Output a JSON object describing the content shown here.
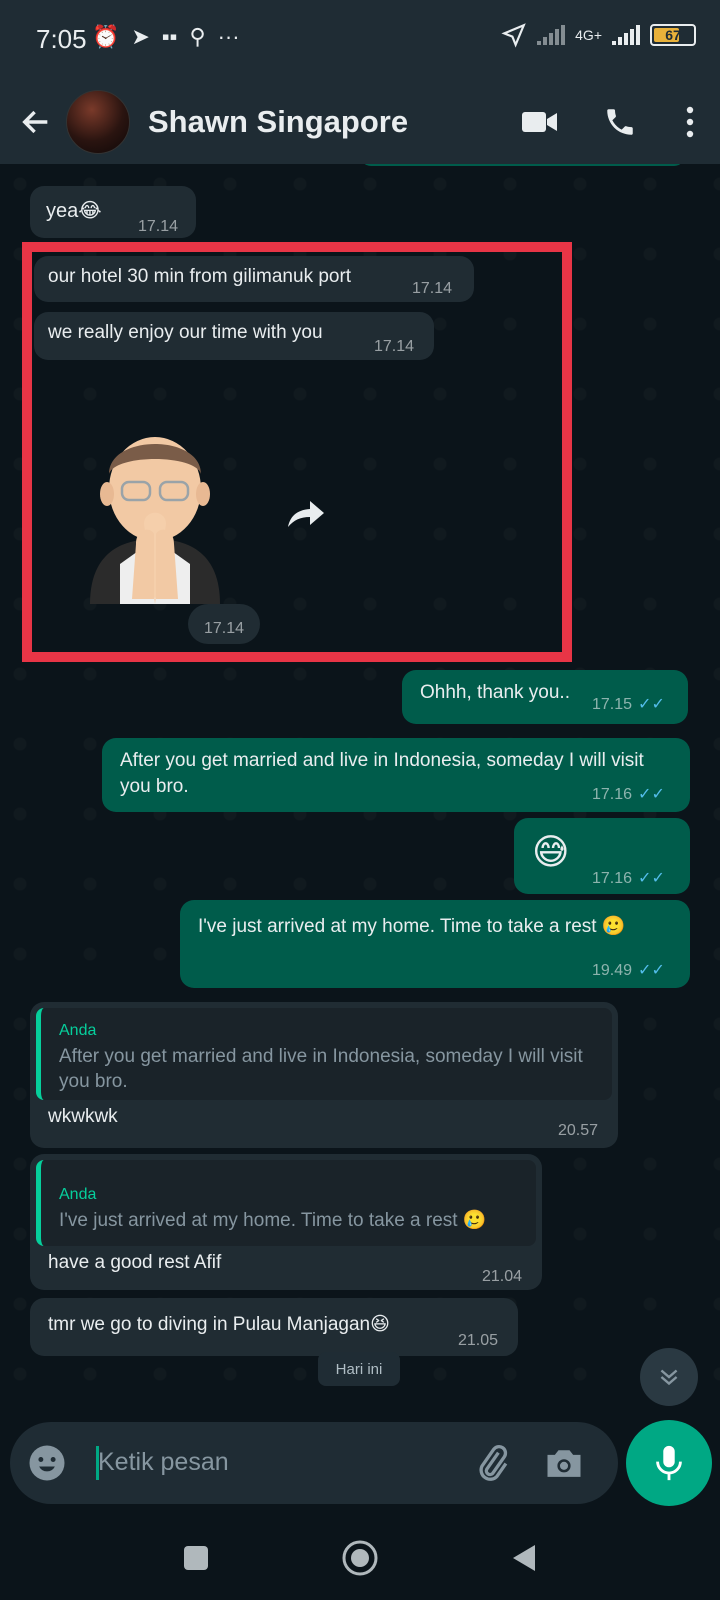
{
  "status_bar": {
    "time": "7:05",
    "network": "4G+",
    "battery": "67",
    "battery_level": 0.67
  },
  "header": {
    "contact_name": "Shawn Singapore"
  },
  "messages": {
    "m1": {
      "text": "yea😂",
      "time": "17.14"
    },
    "m2": {
      "text": "our hotel 30 min from gilimanuk port",
      "time": "17.14"
    },
    "m3": {
      "text": "we really enjoy our time with you",
      "time": "17.14"
    },
    "m4": {
      "time": "17.14"
    },
    "m5": {
      "text": "Ohhh, thank you..",
      "time": "17.15"
    },
    "m6": {
      "text": "After you get married and live in Indonesia, someday I will visit you bro.",
      "time": "17.16"
    },
    "m7": {
      "text": "😅",
      "time": "17.16"
    },
    "m8": {
      "text": "I've just arrived at my home. Time to take a rest 🥲",
      "time": "19.49"
    },
    "m9": {
      "quote_author": "Anda",
      "quote_text": "After you get married and live in Indonesia, someday I will visit you bro.",
      "text": "wkwkwk",
      "time": "20.57"
    },
    "m10": {
      "quote_author": "Anda",
      "quote_text": "I've just arrived at my home. Time to take a rest 🥲",
      "text": "have a good rest Afif",
      "time": "21.04"
    },
    "m11": {
      "text": "tmr we go to diving in Pulau Manjagan😆",
      "time": "21.05"
    }
  },
  "date_chip": "Hari ini",
  "input": {
    "placeholder": "Ketik pesan"
  },
  "colors": {
    "incoming_bubble": "#202c33",
    "outgoing_bubble": "#005c4b",
    "accent": "#00a884",
    "highlight_border": "#e83546",
    "read_ticks": "#53bdeb"
  }
}
